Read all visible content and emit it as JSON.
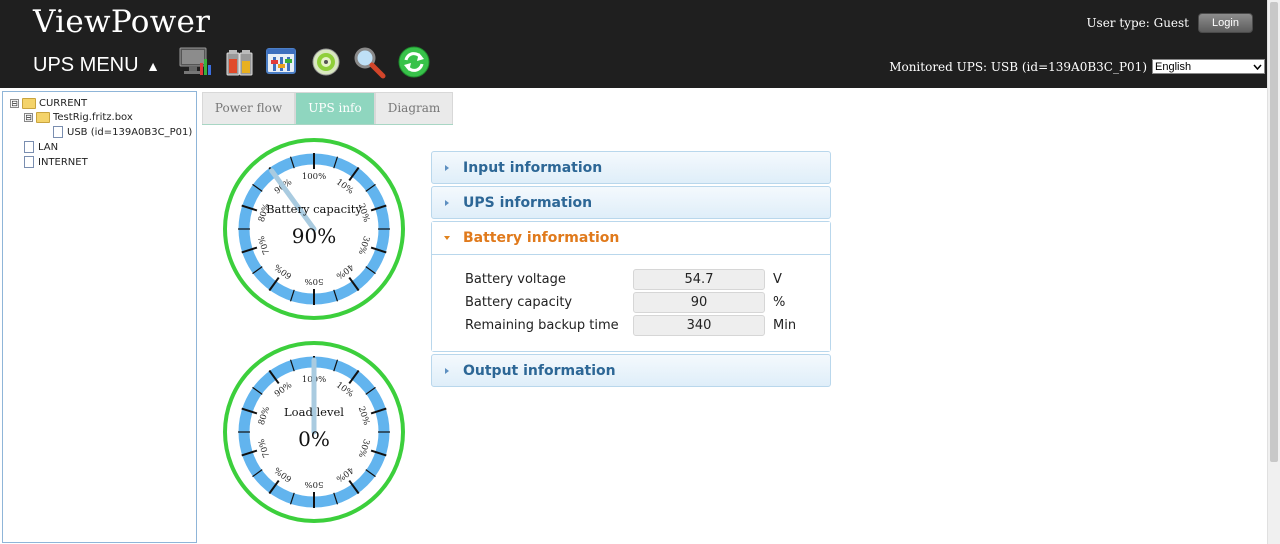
{
  "header": {
    "brand": "ViewPower",
    "menu_title": "UPS MENU",
    "menu_arrow": "▲",
    "user_type_label": "User type: Guest",
    "login_label": "Login",
    "monitored_label": "Monitored UPS: USB (id=139A0B3C_P01)",
    "language_selected": "English",
    "toolbar": [
      {
        "name": "monitor-icon"
      },
      {
        "name": "battery-control-icon"
      },
      {
        "name": "configuration-icon"
      },
      {
        "name": "cd-tool-icon"
      },
      {
        "name": "search-icon"
      },
      {
        "name": "refresh-icon"
      }
    ]
  },
  "tree": {
    "root": "CURRENT",
    "host": "TestRig.fritz.box",
    "device": "USB (id=139A0B3C_P01)",
    "lan": "LAN",
    "internet": "INTERNET",
    "expander_symbol": "⊟"
  },
  "tabs": [
    {
      "label": "Power flow",
      "active": false
    },
    {
      "label": "UPS info",
      "active": true
    },
    {
      "label": "Diagram",
      "active": false
    }
  ],
  "gauges": [
    {
      "label": "Battery capacity",
      "value_text": "90%",
      "value": 90
    },
    {
      "label": "Load level",
      "value_text": "0%",
      "value": 0
    }
  ],
  "gauge_ticks": [
    "100%",
    "10%",
    "20%",
    "30%",
    "40%",
    "50%",
    "60%",
    "70%",
    "80%",
    "90%"
  ],
  "sections": {
    "input": "Input information",
    "ups": "UPS information",
    "battery": "Battery information",
    "output": "Output information"
  },
  "battery": {
    "rows": [
      {
        "label": "Battery voltage",
        "value": "54.7",
        "unit": "V"
      },
      {
        "label": "Battery capacity",
        "value": "90",
        "unit": "%"
      },
      {
        "label": "Remaining backup time",
        "value": "340",
        "unit": "Min"
      }
    ]
  },
  "colors": {
    "gauge_outer": "#3ccf3c",
    "gauge_band": "#62b4ee",
    "needle": "#a9cbe0",
    "accent_tab": "#8fd6bf",
    "header_bg": "#1f1f1f"
  }
}
